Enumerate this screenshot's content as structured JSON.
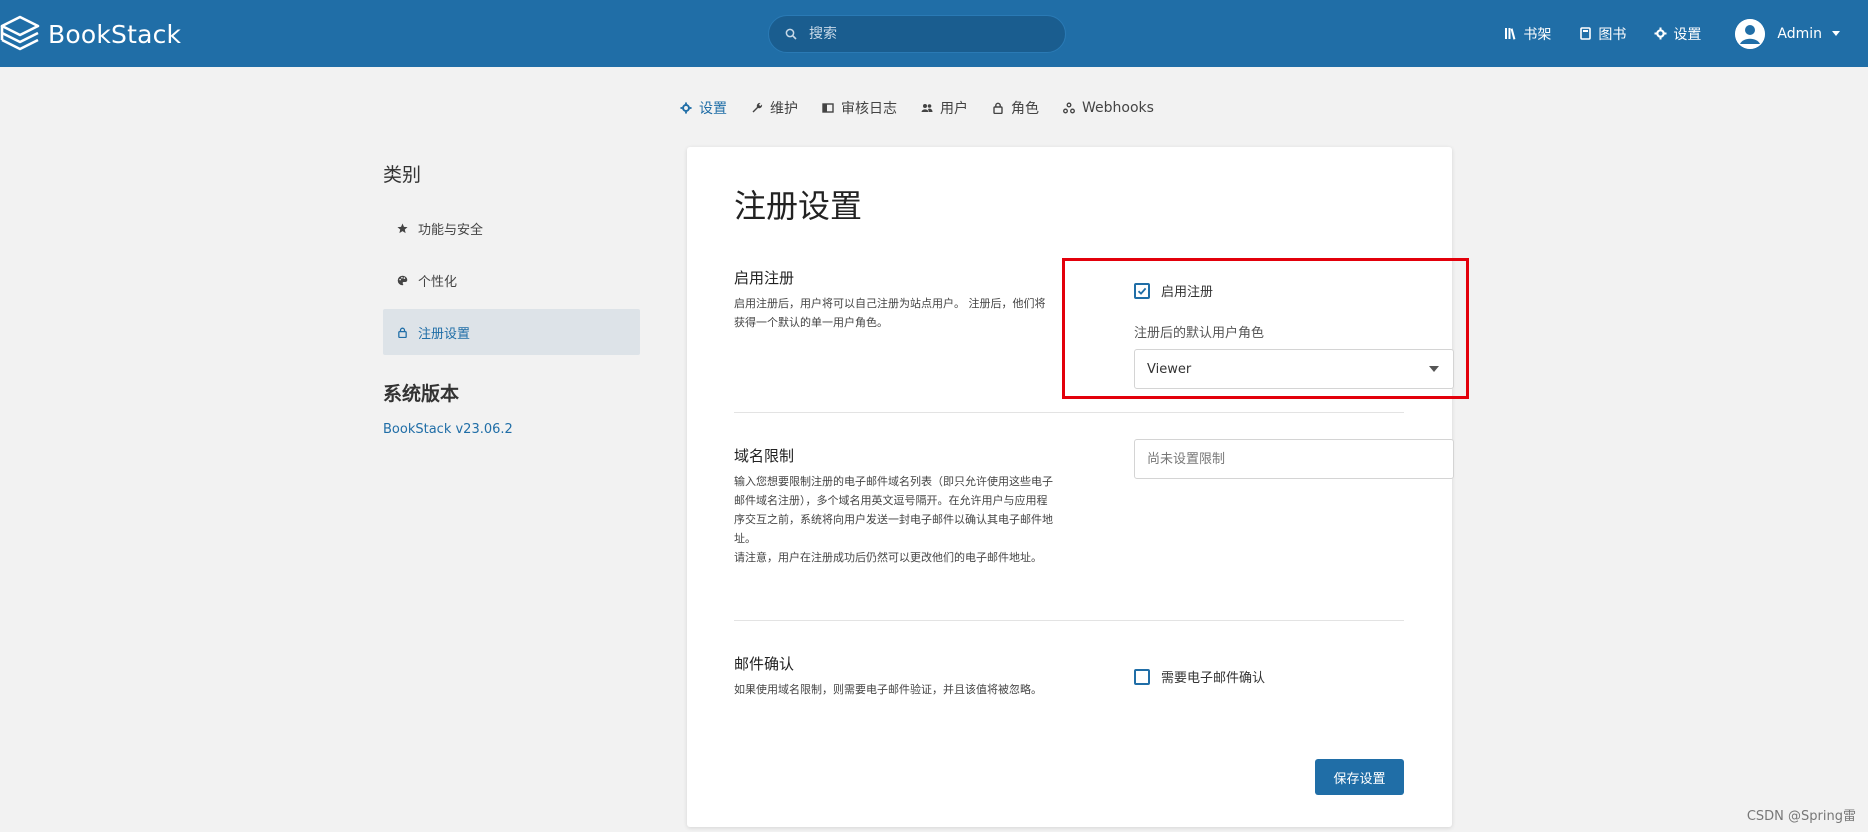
{
  "header": {
    "app_name": "BookStack",
    "search_placeholder": "搜索",
    "nav": [
      {
        "label": "书架",
        "icon": "bookshelf-icon"
      },
      {
        "label": "图书",
        "icon": "book-icon"
      },
      {
        "label": "设置",
        "icon": "gear-icon"
      }
    ],
    "user": {
      "name": "Admin"
    }
  },
  "tabs": [
    {
      "label": "设置",
      "icon": "gear-icon",
      "active": true
    },
    {
      "label": "维护",
      "icon": "wrench-icon"
    },
    {
      "label": "审核日志",
      "icon": "audit-log-icon"
    },
    {
      "label": "用户",
      "icon": "users-icon"
    },
    {
      "label": "角色",
      "icon": "lock-icon"
    },
    {
      "label": "Webhooks",
      "icon": "webhooks-icon"
    }
  ],
  "sidebar": {
    "title": "类别",
    "items": [
      {
        "label": "功能与安全",
        "icon": "star-icon"
      },
      {
        "label": "个性化",
        "icon": "palette-icon"
      },
      {
        "label": "注册设置",
        "icon": "lock-icon",
        "active": true
      }
    ],
    "version_title": "系统版本",
    "version": "BookStack v23.06.2"
  },
  "main": {
    "title": "注册设置",
    "registration": {
      "heading": "启用注册",
      "description": "启用注册后，用户将可以自己注册为站点用户。 注册后，他们将获得一个默认的单一用户角色。",
      "checkbox_label": "启用注册",
      "checked": true,
      "default_role_label": "注册后的默认用户角色",
      "default_role_value": "Viewer"
    },
    "domain": {
      "heading": "域名限制",
      "description_1": "输入您想要限制注册的电子邮件域名列表（即只允许使用这些电子邮件域名注册），多个域名用英文逗号隔开。在允许用户与应用程序交互之前，系统将向用户发送一封电子邮件以确认其电子邮件地址。",
      "description_2": "请注意，用户在注册成功后仍然可以更改他们的电子邮件地址。",
      "input_placeholder": "尚未设置限制"
    },
    "email_confirm": {
      "heading": "邮件确认",
      "description": "如果使用域名限制，则需要电子邮件验证，并且该值将被忽略。",
      "checkbox_label": "需要电子邮件确认",
      "checked": false
    },
    "save_label": "保存设置"
  },
  "watermark": "CSDN @Spring雷",
  "colors": {
    "brand": "#206ea7",
    "highlight": "#e3000b"
  }
}
